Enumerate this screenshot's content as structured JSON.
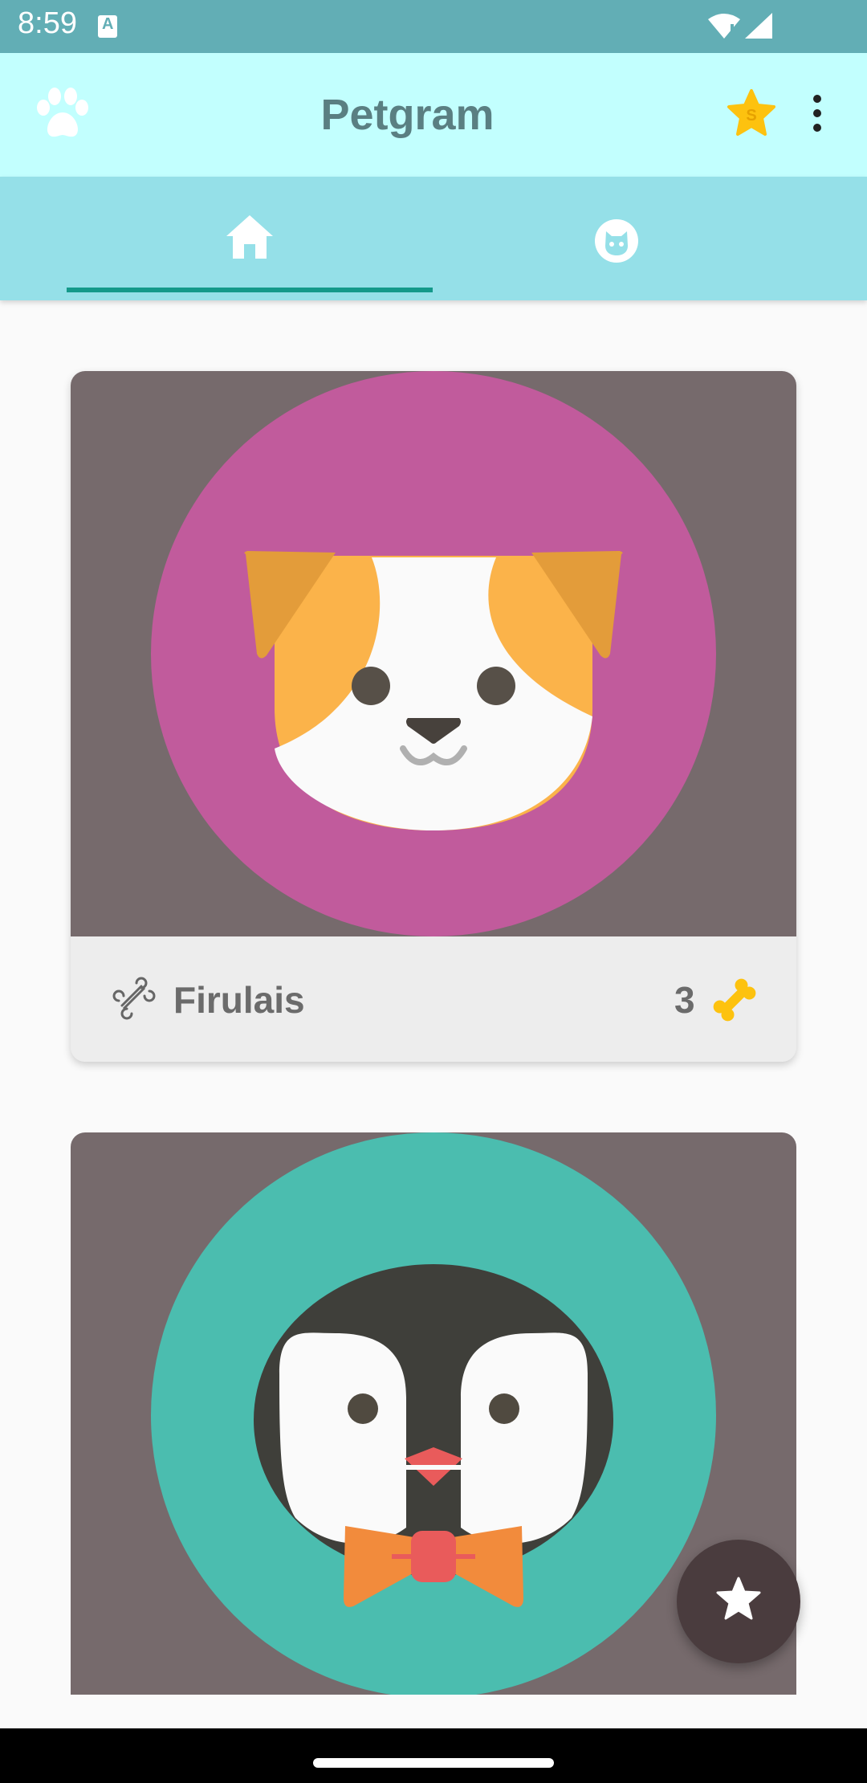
{
  "status_bar": {
    "time": "8:59",
    "a_label": "A"
  },
  "app_bar": {
    "title": "Petgram",
    "star_badge": "S"
  },
  "tabs": [
    {
      "name": "home",
      "icon": "home-icon",
      "selected": true
    },
    {
      "name": "pets",
      "icon": "cat-face-icon",
      "selected": false
    }
  ],
  "cards": [
    {
      "name": "Firulais",
      "likes": "3",
      "image": "dog-face",
      "circle_color": "#c15b9c"
    },
    {
      "name": "",
      "likes": "",
      "image": "penguin-face",
      "circle_color": "#4bbdaf"
    }
  ],
  "colors": {
    "status_bar": "#62aeb5",
    "app_bar": "#c2fffe",
    "tab_bar": "#95e0e8",
    "tab_indicator": "#14998a",
    "card_image_bg": "#766a6c",
    "fab": "#4a3c3e",
    "accent_yellow": "#fdc20f"
  }
}
